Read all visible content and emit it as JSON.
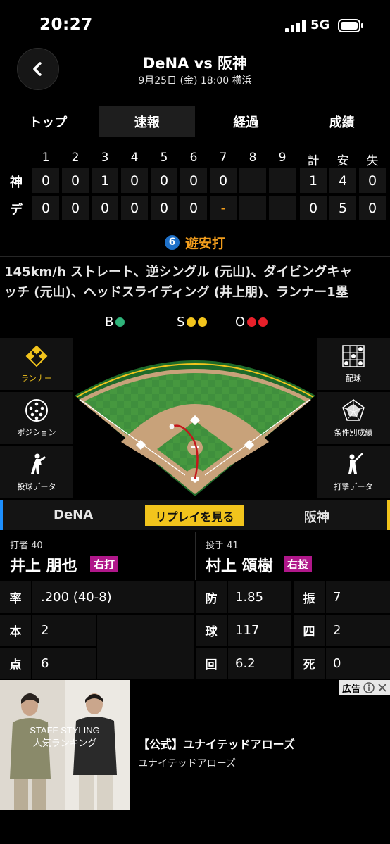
{
  "status_bar": {
    "time": "20:27",
    "network": "5G"
  },
  "header": {
    "title": "DeNA vs 阪神",
    "subtitle": "9月25日 (金) 18:00 横浜"
  },
  "tabs": [
    {
      "label": "トップ",
      "active": false
    },
    {
      "label": "速報",
      "active": true
    },
    {
      "label": "経過",
      "active": false
    },
    {
      "label": "成績",
      "active": false
    }
  ],
  "scoreboard": {
    "headers": [
      "1",
      "2",
      "3",
      "4",
      "5",
      "6",
      "7",
      "8",
      "9",
      "計",
      "安",
      "失"
    ],
    "rows": [
      {
        "team": "神",
        "innings": [
          "0",
          "0",
          "1",
          "0",
          "0",
          "0",
          "0",
          "",
          ""
        ],
        "totals": [
          "1",
          "4",
          "0"
        ]
      },
      {
        "team": "デ",
        "innings": [
          "0",
          "0",
          "0",
          "0",
          "0",
          "0",
          "-",
          "",
          ""
        ],
        "totals": [
          "0",
          "5",
          "0"
        ]
      }
    ]
  },
  "play": {
    "position_number": "6",
    "result": "遊安打",
    "description_line1": "145km/h ストレート、逆シングル (元山)、ダイビングキャ",
    "description_line2": "ッチ (元山)、ヘッドスライディング (井上朋)、ランナー1塁"
  },
  "count": {
    "balls_label": "B",
    "balls": 1,
    "strikes_label": "S",
    "strikes": 2,
    "outs_label": "O",
    "outs": 2,
    "colors": {
      "ball": "#2fb37a",
      "strike": "#f2c41c",
      "out": "#e8202a"
    }
  },
  "left_menu": [
    {
      "label": "ランナー",
      "icon": "diamond-runner-icon",
      "active": true
    },
    {
      "label": "ポジション",
      "icon": "positions-icon",
      "active": false
    },
    {
      "label": "投球データ",
      "icon": "pitcher-icon",
      "active": false
    }
  ],
  "right_menu": [
    {
      "label": "配球",
      "icon": "pitch-grid-icon"
    },
    {
      "label": "条件別成績",
      "icon": "radar-chart-icon"
    },
    {
      "label": "打撃データ",
      "icon": "batter-icon"
    }
  ],
  "team_bar": {
    "home": "DeNA",
    "away": "阪神",
    "replay": "リプレイを見る"
  },
  "batter": {
    "role": "打者 40",
    "name": "井上 朋也",
    "hand": "右打",
    "stats": [
      {
        "label": "率",
        "value": ".200 (40-8)"
      },
      {
        "label": "本",
        "value": "2"
      },
      {
        "label": "点",
        "value": "6"
      }
    ]
  },
  "pitcher": {
    "role": "投手 41",
    "name": "村上 頌樹",
    "hand": "右投",
    "stats": [
      {
        "label": "防",
        "value": "1.85"
      },
      {
        "label": "振",
        "value": "7"
      },
      {
        "label": "球",
        "value": "117"
      },
      {
        "label": "四",
        "value": "2"
      },
      {
        "label": "回",
        "value": "6.2"
      },
      {
        "label": "死",
        "value": "0"
      }
    ]
  },
  "ad": {
    "label": "広告",
    "title": "【公式】ユナイテッドアローズ",
    "subtitle": "ユナイテッドアローズ",
    "image_text_1": "STAFF STYLING",
    "image_text_2": "人気ランキング"
  }
}
